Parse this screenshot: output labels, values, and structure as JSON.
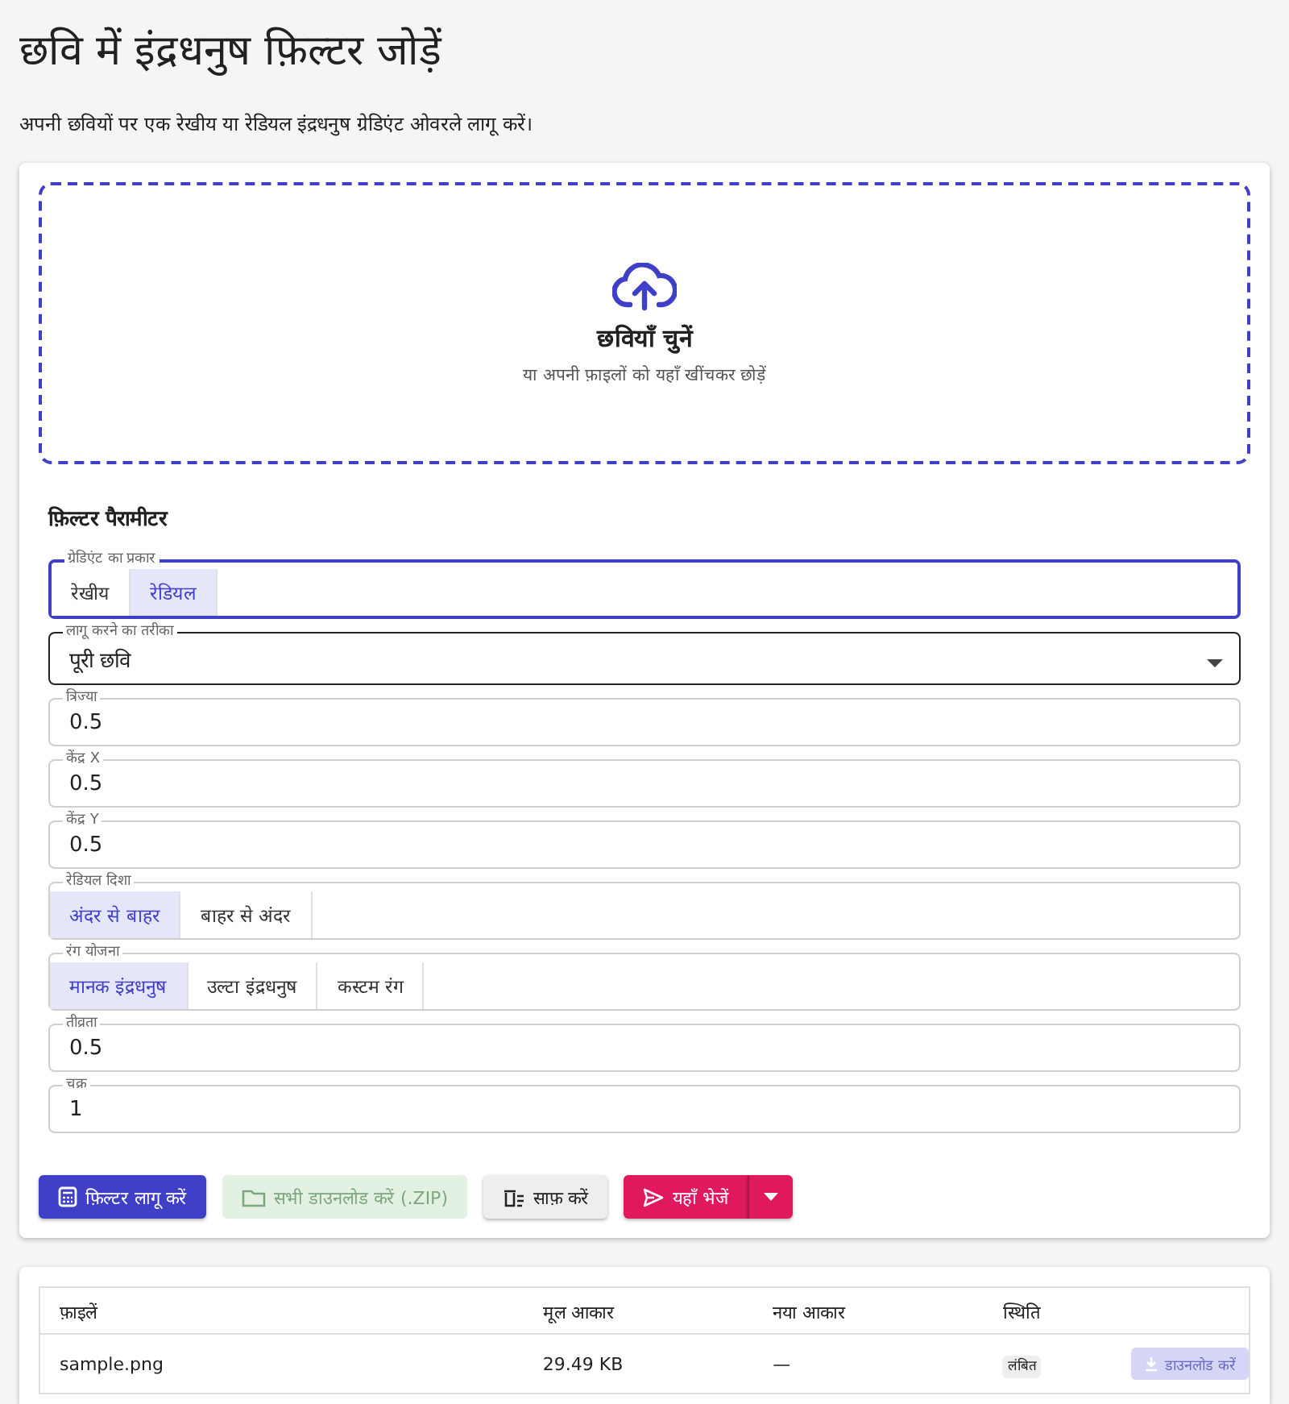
{
  "title": "छवि में इंद्रधनुष फ़िल्टर जोड़ें",
  "subtitle": "अपनी छवियों पर एक रेखीय या रेडियल इंद्रधनुष ग्रेडिएंट ओवरले लागू करें।",
  "dropzone": {
    "title": "छवियाँ चुनें",
    "hint": "या अपनी फ़ाइलों को यहाँ खींचकर छोड़ें"
  },
  "params_heading": "फ़िल्टर पैरामीटर",
  "fields": [
    {
      "kind": "toggle",
      "label": "ग्रेडिएंट का प्रकार",
      "focused": true,
      "options": [
        {
          "label": "रेखीय",
          "selected": false
        },
        {
          "label": "रेडियल",
          "selected": true
        }
      ]
    },
    {
      "kind": "select",
      "label": "लागू करने का तरीका",
      "value": "पूरी छवि"
    },
    {
      "kind": "number",
      "label": "त्रिज्या",
      "value": "0.5"
    },
    {
      "kind": "number",
      "label": "केंद्र X",
      "value": "0.5"
    },
    {
      "kind": "number",
      "label": "केंद्र Y",
      "value": "0.5"
    },
    {
      "kind": "toggle",
      "label": "रेडियल दिशा",
      "focused": false,
      "options": [
        {
          "label": "अंदर से बाहर",
          "selected": true
        },
        {
          "label": "बाहर से अंदर",
          "selected": false
        }
      ]
    },
    {
      "kind": "toggle",
      "label": "रंग योजना",
      "focused": false,
      "options": [
        {
          "label": "मानक इंद्रधनुष",
          "selected": true
        },
        {
          "label": "उल्टा इंद्रधनुष",
          "selected": false
        },
        {
          "label": "कस्टम रंग",
          "selected": false
        }
      ]
    },
    {
      "kind": "number",
      "label": "तीव्रता",
      "value": "0.5"
    },
    {
      "kind": "number",
      "label": "चक्र",
      "value": "1"
    }
  ],
  "buttons": [
    {
      "kind": "apply",
      "label": "फ़िल्टर लागू करें",
      "disabled": false
    },
    {
      "kind": "zip",
      "label": "सभी डाउनलोड करें (.ZIP)",
      "disabled": true
    },
    {
      "kind": "clear",
      "label": "साफ़ करें",
      "disabled": false
    },
    {
      "kind": "send",
      "label": "यहाँ भेजें",
      "disabled": false
    }
  ],
  "table": {
    "columns": [
      "फ़ाइलें",
      "मूल आकार",
      "नया आकार",
      "स्थिति"
    ],
    "rows": [
      {
        "file": "sample.png",
        "original_size": "29.49 KB",
        "new_size": "—",
        "status": "लंबित",
        "action": {
          "label": "डाउनलोड करें",
          "disabled": true
        }
      }
    ]
  }
}
